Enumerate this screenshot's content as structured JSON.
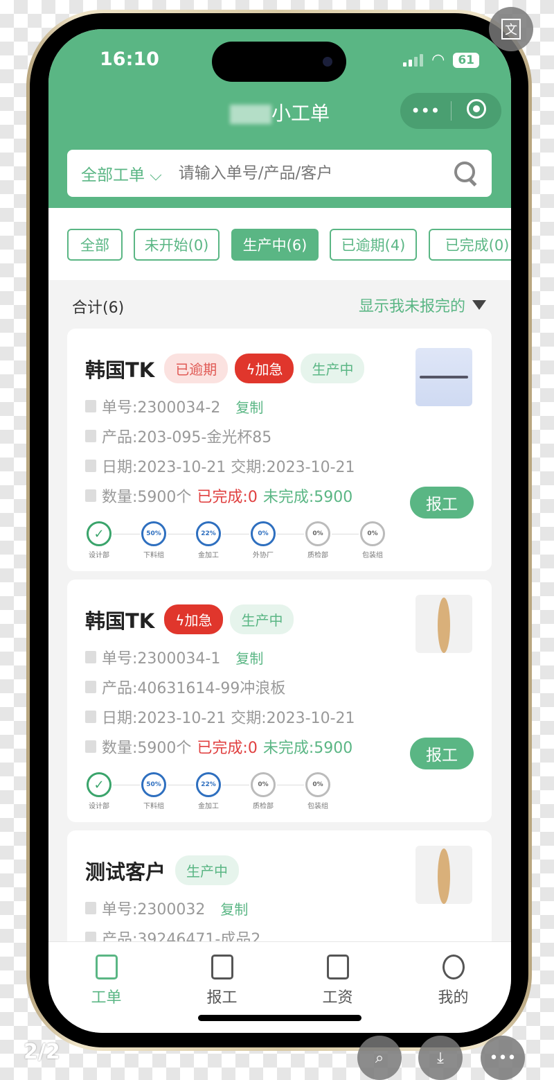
{
  "status": {
    "time": "16:10",
    "battery": "61"
  },
  "app": {
    "title": "小工单",
    "more_icon": "more-dots-icon",
    "close_icon": "target-icon"
  },
  "search": {
    "scope": "全部工单",
    "placeholder": "请输入单号/产品/客户"
  },
  "tabs": [
    {
      "label": "全部",
      "active": false
    },
    {
      "label": "未开始(0)",
      "active": false
    },
    {
      "label": "生产中(6)",
      "active": true
    },
    {
      "label": "已逾期(4)",
      "active": false
    },
    {
      "label": "已完成(0)",
      "active": false
    }
  ],
  "summary": {
    "total": "合计(6)",
    "filter": "显示我未报完的"
  },
  "cards": [
    {
      "customer": "韩国TK",
      "tags": [
        {
          "type": "overdue",
          "text": "已逾期"
        },
        {
          "type": "urgent",
          "text": "ϟ加急"
        },
        {
          "type": "prod",
          "text": "生产中"
        }
      ],
      "order_no": "单号:2300034-2",
      "copy": "复制",
      "product": "产品:203-095-金光杯85",
      "dates": "日期:2023-10-21 交期:2023-10-21",
      "qty": "数量:5900个",
      "done": "已完成:0",
      "todo": "未完成:5900",
      "report": "报工",
      "image": "rod",
      "steps": [
        {
          "label": "设计部",
          "value": "✓",
          "state": "done"
        },
        {
          "label": "下料组",
          "value": "50%",
          "state": "prog"
        },
        {
          "label": "金加工",
          "value": "22%",
          "state": "prog"
        },
        {
          "label": "外协厂",
          "value": "0%",
          "state": "prog"
        },
        {
          "label": "质检部",
          "value": "0%",
          "state": "idle"
        },
        {
          "label": "包装组",
          "value": "0%",
          "state": "idle"
        }
      ]
    },
    {
      "customer": "韩国TK",
      "tags": [
        {
          "type": "urgent",
          "text": "ϟ加急"
        },
        {
          "type": "prod",
          "text": "生产中"
        }
      ],
      "order_no": "单号:2300034-1",
      "copy": "复制",
      "product": "产品:40631614-99冲浪板",
      "dates": "日期:2023-10-21 交期:2023-10-21",
      "qty": "数量:5900个",
      "done": "已完成:0",
      "todo": "未完成:5900",
      "report": "报工",
      "image": "board",
      "steps": [
        {
          "label": "设计部",
          "value": "✓",
          "state": "done"
        },
        {
          "label": "下料组",
          "value": "50%",
          "state": "prog"
        },
        {
          "label": "金加工",
          "value": "22%",
          "state": "prog"
        },
        {
          "label": "质检部",
          "value": "0%",
          "state": "idle"
        },
        {
          "label": "包装组",
          "value": "0%",
          "state": "idle"
        }
      ]
    },
    {
      "customer": "测试客户",
      "tags": [
        {
          "type": "prod",
          "text": "生产中"
        }
      ],
      "order_no": "单号:2300032",
      "copy": "复制",
      "product": "产品:39246471-成品2",
      "image": "board"
    }
  ],
  "tabbar": [
    {
      "label": "工单",
      "active": true
    },
    {
      "label": "报工",
      "active": false
    },
    {
      "label": "工资",
      "active": false
    },
    {
      "label": "我的",
      "active": false
    }
  ],
  "viewer": {
    "page": "2/2",
    "translate": "文"
  },
  "colors": {
    "primary": "#5ab684",
    "urgent": "#e0362c",
    "progress": "#2e6fbf"
  }
}
